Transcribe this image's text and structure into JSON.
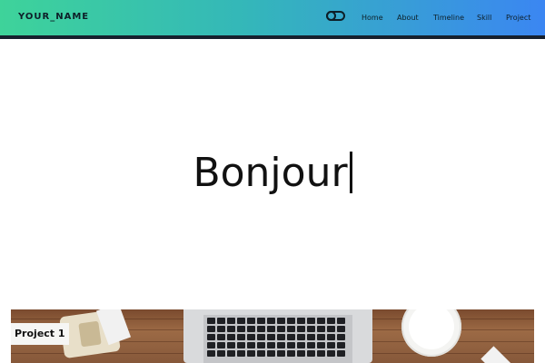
{
  "navbar": {
    "brand": "YOUR_NAME",
    "theme_toggle_icon": "toggle-switch-icon",
    "links": [
      "Home",
      "About",
      "Timeline",
      "Skill",
      "Project"
    ],
    "gradient_colors": [
      "#3ed39a",
      "#34b7b9",
      "#3b86f2"
    ],
    "bottom_border_color": "#16202e"
  },
  "hero": {
    "typed_text": "Bonjour"
  },
  "projects": {
    "items": [
      {
        "label": "Project 1"
      }
    ]
  }
}
